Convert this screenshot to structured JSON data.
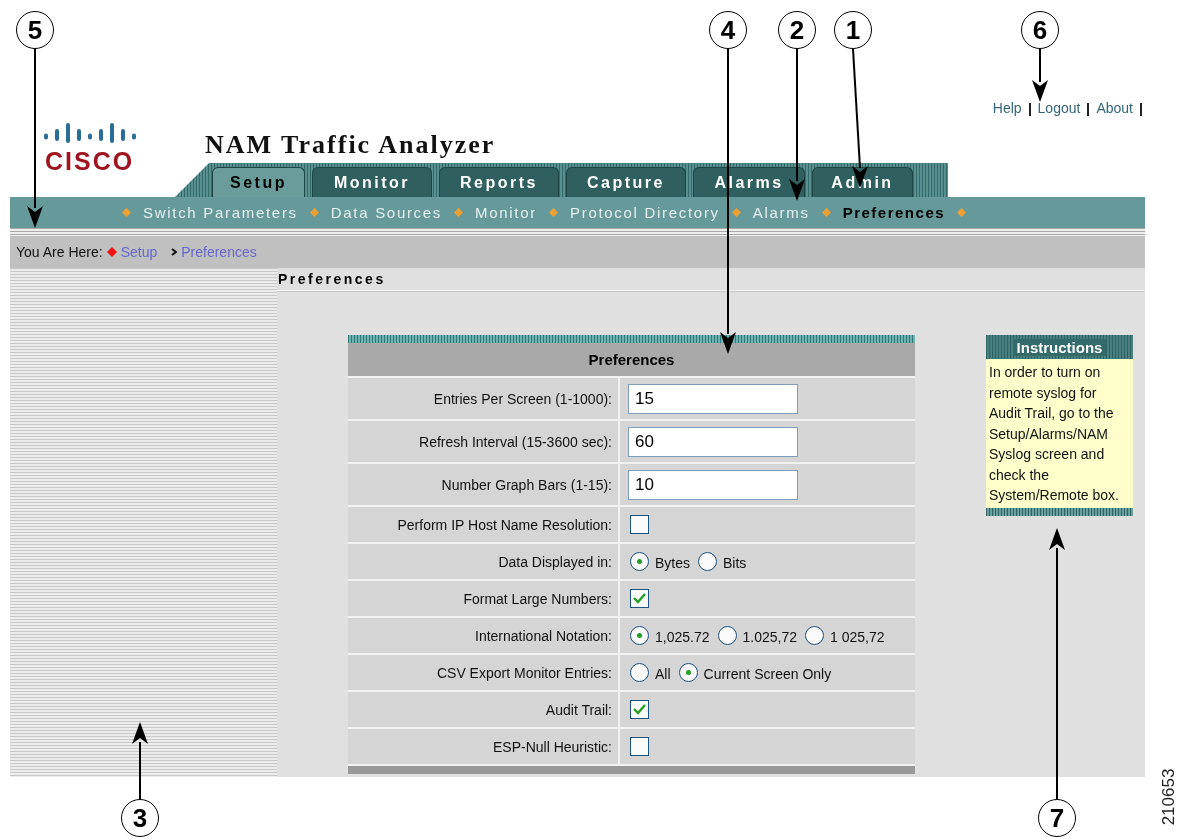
{
  "callouts": [
    {
      "number": "5"
    },
    {
      "number": "4"
    },
    {
      "number": "2"
    },
    {
      "number": "1"
    },
    {
      "number": "6"
    },
    {
      "number": "3"
    },
    {
      "number": "7"
    }
  ],
  "header": {
    "logo_text": "CISCO",
    "title": "NAM Traffic Analyzer"
  },
  "top_links": [
    "Help",
    "Logout",
    "About"
  ],
  "tabs": [
    {
      "label": "Setup",
      "selected": true
    },
    {
      "label": "Monitor",
      "selected": false
    },
    {
      "label": "Reports",
      "selected": false
    },
    {
      "label": "Capture",
      "selected": false
    },
    {
      "label": "Alarms",
      "selected": false
    },
    {
      "label": "Admin",
      "selected": false
    }
  ],
  "subnav": [
    {
      "label": "Switch Parameters",
      "selected": false
    },
    {
      "label": "Data Sources",
      "selected": false
    },
    {
      "label": "Monitor",
      "selected": false
    },
    {
      "label": "Protocol Directory",
      "selected": false
    },
    {
      "label": "Alarms",
      "selected": false
    },
    {
      "label": "Preferences",
      "selected": true
    }
  ],
  "breadcrumb": {
    "label": "You Are Here:",
    "items": [
      "Setup",
      "Preferences"
    ]
  },
  "page_title": "Preferences",
  "form": {
    "title": "Preferences",
    "rows": [
      {
        "kind": "text",
        "label": "Entries Per Screen (1-1000):",
        "value": "15"
      },
      {
        "kind": "text",
        "label": "Refresh Interval (15-3600 sec):",
        "value": "60"
      },
      {
        "kind": "text",
        "label": "Number Graph Bars (1-15):",
        "value": "10"
      },
      {
        "kind": "checkbox",
        "label": "Perform IP Host Name Resolution:",
        "checked": false
      },
      {
        "kind": "radio",
        "label": "Data Displayed in:",
        "options": [
          {
            "label": "Bytes",
            "selected": true
          },
          {
            "label": "Bits",
            "selected": false
          }
        ]
      },
      {
        "kind": "checkbox",
        "label": "Format Large Numbers:",
        "checked": true
      },
      {
        "kind": "radio",
        "label": "International Notation:",
        "options": [
          {
            "label": "1,025.72",
            "selected": true
          },
          {
            "label": "1.025,72",
            "selected": false
          },
          {
            "label": "1 025,72",
            "selected": false
          }
        ]
      },
      {
        "kind": "radio",
        "label": "CSV Export Monitor Entries:",
        "options": [
          {
            "label": "All",
            "selected": false
          },
          {
            "label": "Current Screen Only",
            "selected": true
          }
        ]
      },
      {
        "kind": "checkbox",
        "label": "Audit Trail:",
        "checked": true
      },
      {
        "kind": "checkbox",
        "label": "ESP-Null Heuristic:",
        "checked": false
      }
    ]
  },
  "instructions": {
    "title": "Instructions",
    "text": "In order to turn on remote syslog for Audit Trail, go to the Setup/Alarms/NAM Syslog screen and check the System/Remote box."
  },
  "figure_number": "210653"
}
